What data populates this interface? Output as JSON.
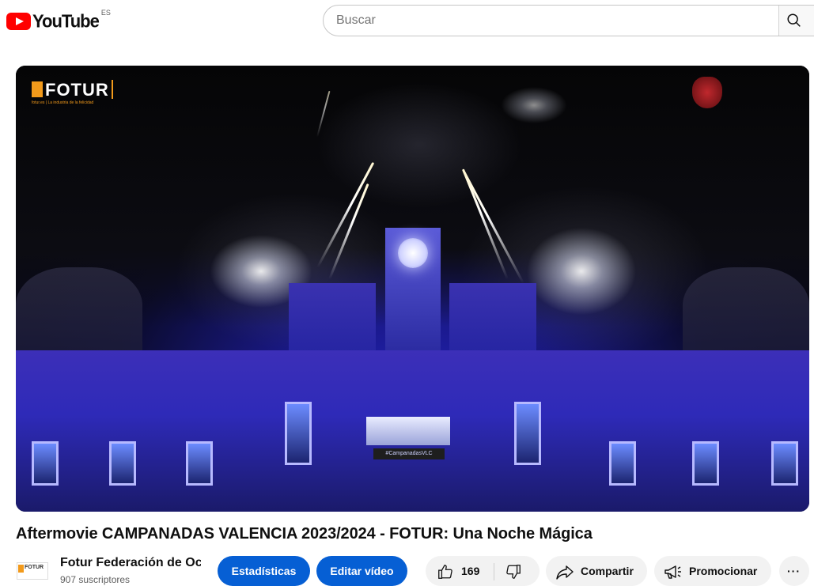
{
  "header": {
    "logo_text": "YouTube",
    "country_code": "ES",
    "search_placeholder": "Buscar"
  },
  "video": {
    "overlay_logo": "FOTUR",
    "overlay_tagline": "fotur.es | La industria de la felicidad",
    "screen_caption": "#CampanadasVLC"
  },
  "title": "Aftermovie CAMPANADAS VALENCIA 2023/2024 - FOTUR: Una Noche Mágica",
  "channel": {
    "avatar_text": "FOTUR",
    "name": "Fotur Federación de Ocio",
    "subscribers": "907 suscriptores"
  },
  "actions": {
    "stats_label": "Estadísticas",
    "edit_label": "Editar vídeo",
    "likes": "169",
    "share_label": "Compartir",
    "promote_label": "Promocionar",
    "more_label": "···"
  },
  "colors": {
    "brand_red": "#ff0000",
    "accent_blue": "#065fd4",
    "fotur_orange": "#f29a1b"
  }
}
